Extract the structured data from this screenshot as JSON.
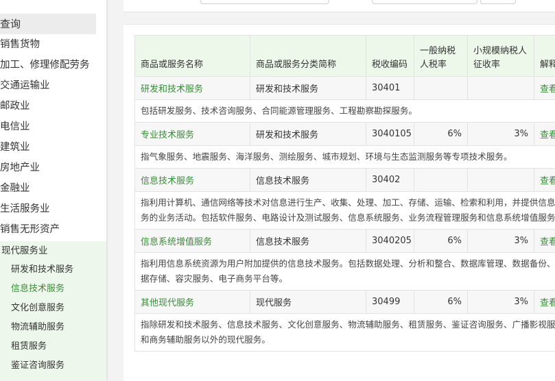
{
  "sidebar": {
    "query_label": "查询",
    "categories": [
      "销售货物",
      "加工、修理修配劳务",
      "交通运输业",
      "邮政业",
      "电信业",
      "建筑业",
      "房地产业",
      "金融业",
      "生活服务业",
      "销售无形资产"
    ],
    "group_title": "现代服务业",
    "subitems": [
      "研发和技术服务",
      "信息技术服务",
      "文化创意服务",
      "物流辅助服务",
      "租赁服务",
      "鉴证咨询服务"
    ],
    "active_subitem": "信息技术服务"
  },
  "table": {
    "headers": {
      "name": "商品或服务名称",
      "category": "商品或服务分类简称",
      "code": "税收编码",
      "general_rate": "一般纳税人税率",
      "small_rate": "小规模纳税人征收率",
      "explain": "解释"
    },
    "view_label": "查看",
    "rows": [
      {
        "name": "研发和技术服务",
        "category": "研发和技术服务",
        "code": "30401",
        "general_rate": "",
        "small_rate": "",
        "description": "包括研发服务、技术咨询服务、合同能源管理服务、工程勘察勘探服务。"
      },
      {
        "name": "专业技术服务",
        "category": "研发和技术服务",
        "code": "3040105",
        "general_rate": "6%",
        "small_rate": "3%",
        "description": "指气象服务、地震服务、海洋服务、测绘服务、城市规划、环境与生态监测服务等专项技术服务。"
      },
      {
        "name": "信息技术服务",
        "category": "信息技术服务",
        "code": "30402",
        "general_rate": "",
        "small_rate": "",
        "description": "指利用计算机、通信网络等技术对信息进行生产、收集、处理、加工、存储、运输、检索和利用，并提供信息服务的业务活动。包括软件服务、电路设计及测试服务、信息系统服务、业务流程管理服务和信息系统增值服务。"
      },
      {
        "name": "信息系统增值服务",
        "category": "信息技术服务",
        "code": "3040205",
        "general_rate": "6%",
        "small_rate": "3%",
        "description": "指利用信息系统资源为用户附加提供的信息技术服务。包括数据处理、分析和整合、数据库管理、数据备份、数据存储、容灾服务、电子商务平台等。"
      },
      {
        "name": "其他现代服务",
        "category": "现代服务",
        "code": "30499",
        "general_rate": "6%",
        "small_rate": "3%",
        "description": "指除研发和技术服务、信息技术服务、文化创意服务、物流辅助服务、租赁服务、鉴证咨询服务、广播影视服务和商务辅助服务以外的现代服务。"
      }
    ]
  },
  "colors": {
    "accent_green": "#3a8b3a",
    "header_bg": "#edf8ea",
    "sidebar_group_bg": "#eef7ec"
  }
}
